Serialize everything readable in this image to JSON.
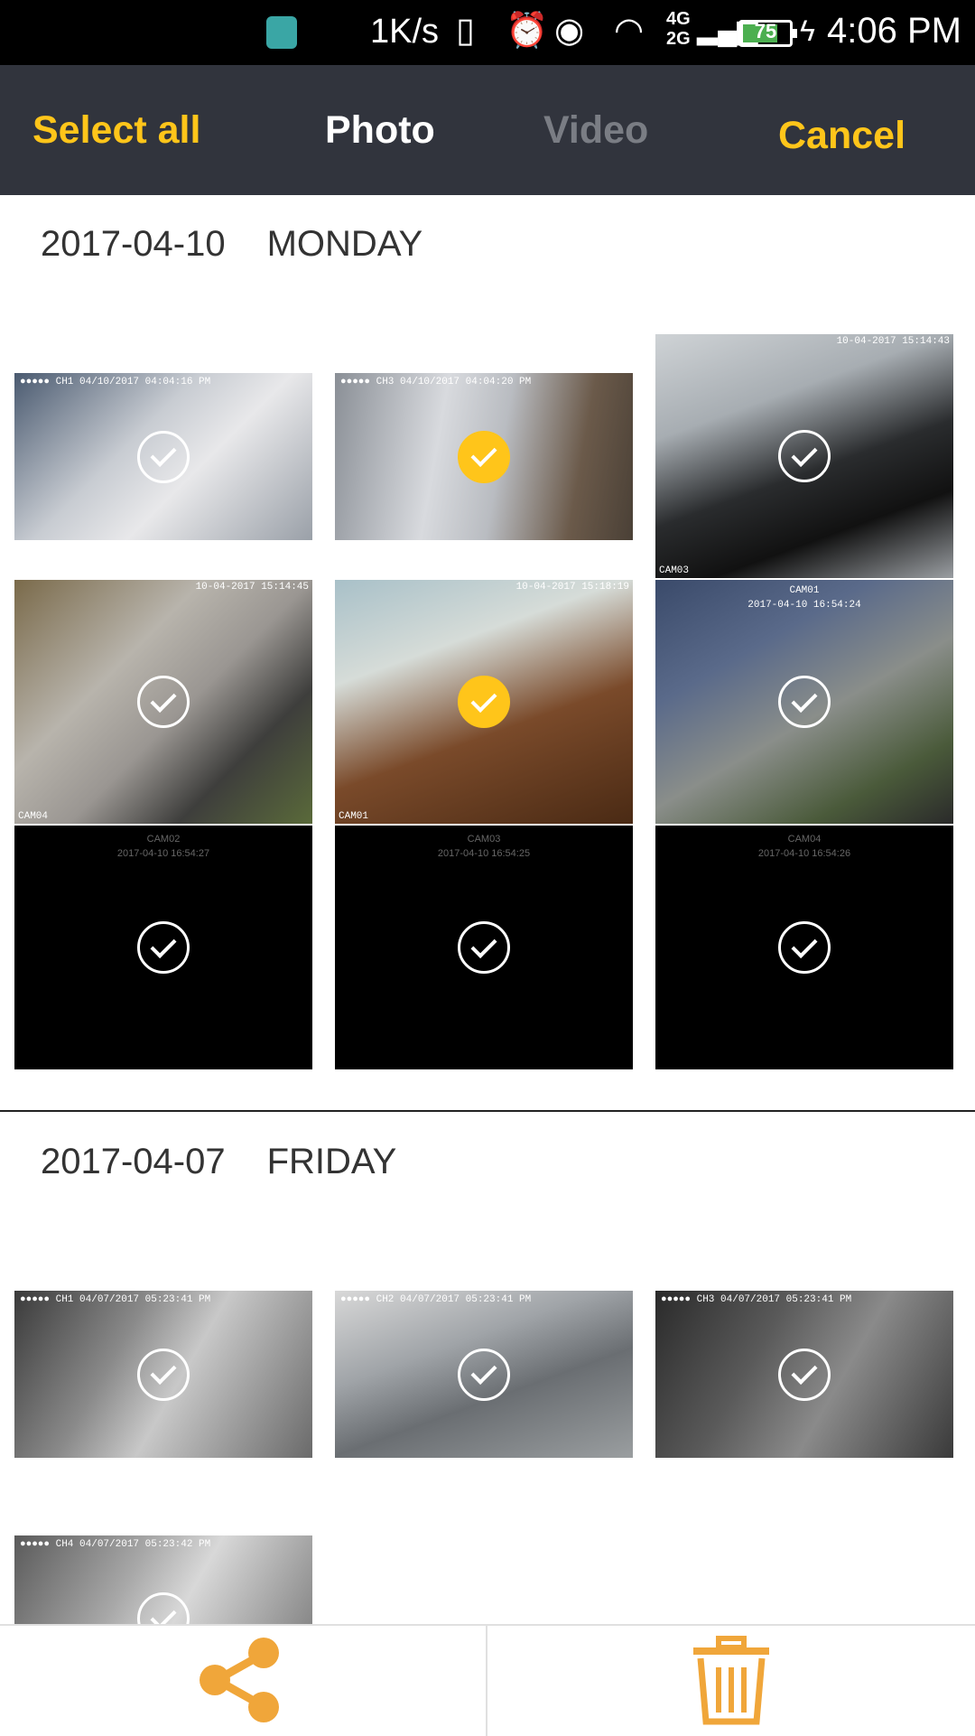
{
  "status_bar": {
    "speed": "1K/s",
    "network_top": "4G",
    "network_bottom": "2G",
    "battery_level": "75",
    "time": "4:06 PM"
  },
  "header": {
    "select_all": "Select all",
    "tab_photo": "Photo",
    "tab_video": "Video",
    "cancel": "Cancel"
  },
  "sections": [
    {
      "date": "2017-04-10",
      "weekday": "MONDAY",
      "thumbnails": [
        {
          "overlay": "●●●●● CH1 04/10/2017 04:04:16 PM",
          "selected": false
        },
        {
          "overlay": "●●●●● CH3 04/10/2017 04:04:20 PM",
          "selected": true
        },
        {
          "overlay": "10-04-2017 15:14:43",
          "corner": "CAM03",
          "selected": false
        },
        {
          "overlay": "10-04-2017 15:14:45",
          "corner": "CAM04",
          "selected": false
        },
        {
          "overlay": "10-04-2017 15:18:19",
          "corner": "CAM01",
          "selected": true
        },
        {
          "overlay": "2017-04-10 16:54:24",
          "corner": "CAM01",
          "selected": false
        },
        {
          "cam": "CAM02",
          "timestamp": "2017-04-10 16:54:27",
          "selected": false
        },
        {
          "cam": "CAM03",
          "timestamp": "2017-04-10 16:54:25",
          "selected": false
        },
        {
          "cam": "CAM04",
          "timestamp": "2017-04-10 16:54:26",
          "selected": false
        }
      ]
    },
    {
      "date": "2017-04-07",
      "weekday": "FRIDAY",
      "thumbnails": [
        {
          "overlay": "●●●●● CH1 04/07/2017 05:23:41 PM",
          "selected": false
        },
        {
          "overlay": "●●●●● CH2 04/07/2017 05:23:41 PM",
          "selected": false
        },
        {
          "overlay": "●●●●● CH3 04/07/2017 05:23:41 PM",
          "selected": false
        },
        {
          "overlay": "●●●●● CH4 04/07/2017 05:23:42 PM",
          "selected": false
        }
      ]
    }
  ],
  "colors": {
    "accent": "#ffc51a",
    "header_bg": "#31343d",
    "bottom_icon": "#f0a63a"
  },
  "bottom_bar": {
    "share_icon": "share-icon",
    "delete_icon": "trash-icon"
  }
}
